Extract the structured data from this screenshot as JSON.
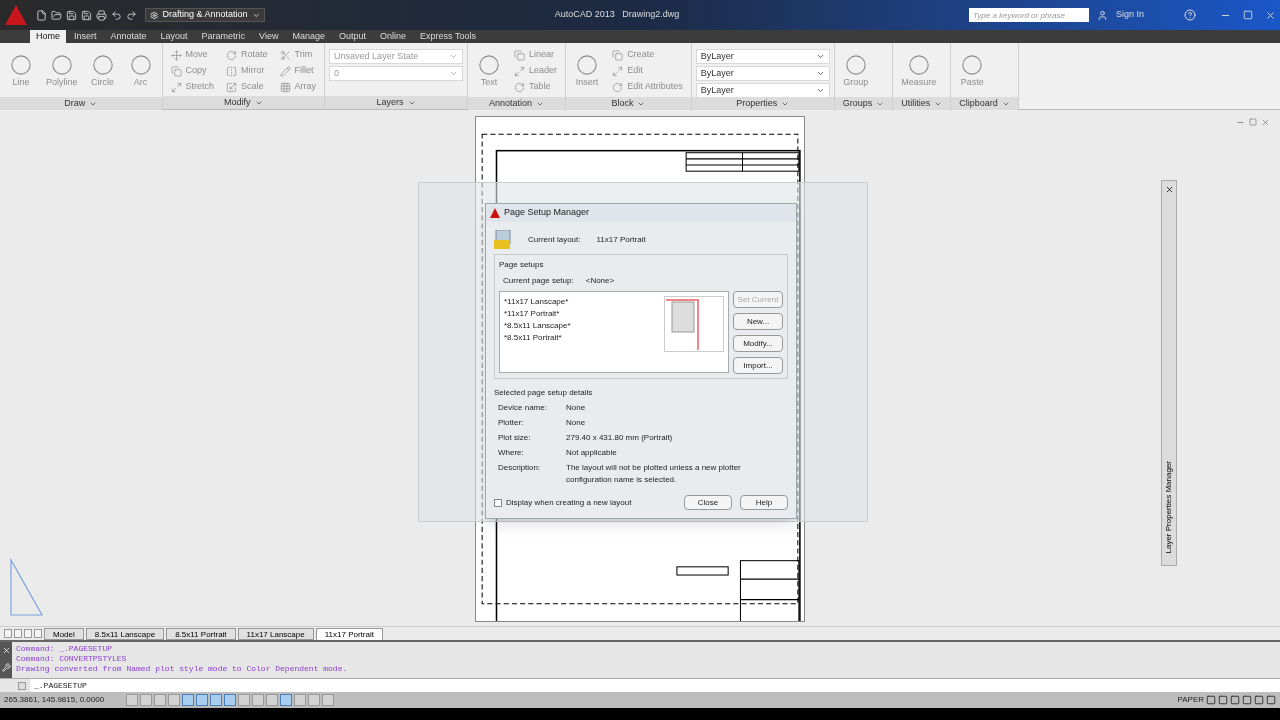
{
  "title_bar": {
    "workspace": "Drafting & Annotation",
    "title": "AutoCAD 2013   Drawing2.dwg",
    "search": {
      "placeholder": "Type a keyword or phrase"
    },
    "sign_in": "Sign In"
  },
  "ribbon_tabs": [
    {
      "label": "Home",
      "selected": true
    },
    {
      "label": "Insert",
      "selected": false
    },
    {
      "label": "Annotate",
      "selected": false
    },
    {
      "label": "Layout",
      "selected": false
    },
    {
      "label": "Parametric",
      "selected": false
    },
    {
      "label": "View",
      "selected": false
    },
    {
      "label": "Manage",
      "selected": false
    },
    {
      "label": "Output",
      "selected": false
    },
    {
      "label": "Online",
      "selected": false
    },
    {
      "label": "Express Tools",
      "selected": false
    }
  ],
  "ribbon_panels": [
    {
      "title": "Draw",
      "tools": [
        {
          "kind": "large",
          "label": "Line",
          "disabled": true
        },
        {
          "kind": "large",
          "label": "Polyline",
          "disabled": true
        },
        {
          "kind": "large",
          "label": "Circle",
          "disabled": true
        },
        {
          "kind": "large",
          "label": "Arc",
          "disabled": true
        }
      ]
    },
    {
      "title": "Modify",
      "tools": [
        {
          "kind": "small",
          "label": "Move",
          "disabled": true
        },
        {
          "kind": "small",
          "label": "Copy",
          "disabled": true
        },
        {
          "kind": "small",
          "label": "Stretch",
          "disabled": true
        },
        {
          "kind": "small",
          "label": "Rotate",
          "disabled": true
        },
        {
          "kind": "small",
          "label": "Mirror",
          "disabled": true
        },
        {
          "kind": "small",
          "label": "Scale",
          "disabled": true
        },
        {
          "kind": "small",
          "label": "Trim",
          "disabled": true
        },
        {
          "kind": "small",
          "label": "Fillet",
          "disabled": true
        },
        {
          "kind": "small",
          "label": "Array",
          "disabled": true
        }
      ]
    },
    {
      "title": "Layers",
      "tools": [
        {
          "kind": "combo",
          "label": "Unsaved Layer State",
          "disabled": true
        },
        {
          "kind": "combo",
          "label": "0",
          "disabled": true
        }
      ]
    },
    {
      "title": "Annotation",
      "tools": [
        {
          "kind": "large",
          "label": "Text",
          "disabled": true
        },
        {
          "kind": "small",
          "label": "Linear",
          "disabled": true
        },
        {
          "kind": "small",
          "label": "Leader",
          "disabled": true
        },
        {
          "kind": "small",
          "label": "Table",
          "disabled": true
        }
      ]
    },
    {
      "title": "Block",
      "tools": [
        {
          "kind": "large",
          "label": "Insert",
          "disabled": true
        },
        {
          "kind": "small",
          "label": "Create",
          "disabled": true
        },
        {
          "kind": "small",
          "label": "Edit",
          "disabled": true
        },
        {
          "kind": "small",
          "label": "Edit Attributes",
          "disabled": true
        }
      ]
    },
    {
      "title": "Properties",
      "tools": [
        {
          "kind": "combo",
          "label": "ByLayer",
          "disabled": false
        },
        {
          "kind": "combo",
          "label": "ByLayer",
          "disabled": false
        },
        {
          "kind": "combo",
          "label": "ByLayer",
          "disabled": false
        }
      ]
    },
    {
      "title": "Groups",
      "tools": [
        {
          "kind": "large",
          "label": "Group",
          "disabled": true
        }
      ]
    },
    {
      "title": "Utilities",
      "tools": [
        {
          "kind": "large",
          "label": "Measure",
          "disabled": true
        }
      ]
    },
    {
      "title": "Clipboard",
      "tools": [
        {
          "kind": "large",
          "label": "Paste",
          "disabled": true
        }
      ]
    }
  ],
  "dialog": {
    "title": "Page Setup Manager",
    "current_layout_label": "Current layout:",
    "current_layout": "11x17 Portrait",
    "page_setups_label": "Page setups",
    "current_setup_label": "Current page setup:",
    "current_setup": "<None>",
    "setups": [
      {
        "label": "*11x17 Lanscape*"
      },
      {
        "label": "*11x17 Portrait*"
      },
      {
        "label": "*8.5x11 Lanscape*"
      },
      {
        "label": "*8.5x11 Portrait*"
      }
    ],
    "side_buttons": [
      {
        "label": "Set Current",
        "disabled": true
      },
      {
        "label": "New...",
        "disabled": false
      },
      {
        "label": "Modify...",
        "disabled": false
      },
      {
        "label": "Import...",
        "disabled": false
      }
    ],
    "details_label": "Selected page setup details",
    "details": [
      {
        "label": "Device name:",
        "value": "None"
      },
      {
        "label": "Plotter:",
        "value": "None"
      },
      {
        "label": "Plot size:",
        "value": "279.40 x 431.80 mm (Portrait)"
      },
      {
        "label": "Where:",
        "value": "Not applicable"
      },
      {
        "label": "Description:",
        "value": "The layout will not be plotted unless a new plotter configuration name is selected."
      }
    ],
    "display_checkbox": {
      "label": "Display when creating a new layout",
      "checked": false
    },
    "footer_buttons": [
      "Close",
      "Help"
    ]
  },
  "palette": {
    "title": "Layer Properties Manager"
  },
  "layout_tabs": [
    {
      "label": "Model",
      "selected": false
    },
    {
      "label": "8.5x11 Lanscape",
      "selected": false
    },
    {
      "label": "8.5x11 Portrait",
      "selected": false
    },
    {
      "label": "11x17 Lanscape",
      "selected": false
    },
    {
      "label": "11x17 Portrait",
      "selected": true
    }
  ],
  "command_history": [
    "Command: _.PAGESETUP",
    "Command: CONVERTPSTYLES",
    "Drawing converted from Named plot style mode to Color Dependent mode."
  ],
  "command_line": {
    "value": "_.PAGESETUP"
  },
  "status_bar": {
    "coordinates": "265.3861, 145.9815, 0.0000",
    "toggles": [
      {
        "on": false
      },
      {
        "on": false
      },
      {
        "on": false
      },
      {
        "on": false
      },
      {
        "on": true
      },
      {
        "on": true
      },
      {
        "on": true
      },
      {
        "on": true
      },
      {
        "on": false
      },
      {
        "on": false
      },
      {
        "on": false
      },
      {
        "on": true
      },
      {
        "on": false
      },
      {
        "on": false
      },
      {
        "on": false
      }
    ],
    "space": "PAPER"
  }
}
